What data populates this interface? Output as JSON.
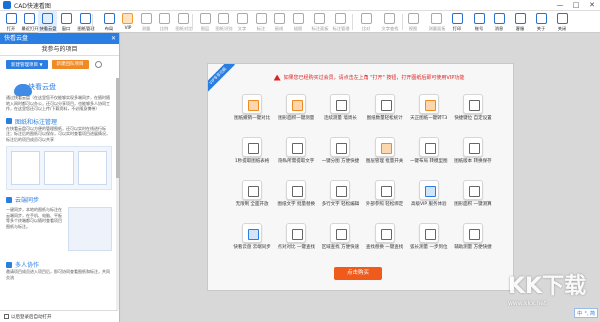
{
  "window": {
    "title": "CAD快速看图",
    "controls": [
      "—",
      "□",
      "✕"
    ]
  },
  "toolbar": {
    "items": [
      {
        "label": "打开",
        "icon": "folder-icon"
      },
      {
        "label": "最近打开",
        "icon": "recent-icon"
      },
      {
        "label": "快看云盘",
        "icon": "cloud-icon"
      },
      {
        "label": "窗口",
        "icon": "window-icon"
      },
      {
        "label": "图纸管理",
        "icon": "drawing-manage-icon"
      },
      {
        "label": "布局",
        "icon": "layout-icon"
      },
      {
        "label": "VIP",
        "icon": "vip-icon"
      },
      {
        "label": "测量",
        "icon": "measure-icon"
      },
      {
        "label": "比例",
        "icon": "scale-icon"
      },
      {
        "label": "图纸对比",
        "icon": "compare-icon"
      },
      {
        "label": "图层",
        "icon": "layers-icon"
      },
      {
        "label": "图纸识别",
        "icon": "recognize-icon"
      },
      {
        "label": "文字",
        "icon": "text-icon"
      },
      {
        "label": "标注",
        "icon": "annotate-icon"
      },
      {
        "label": "画线",
        "icon": "draw-line-icon"
      },
      {
        "label": "插图",
        "icon": "insert-image-icon"
      },
      {
        "label": "标注面板",
        "icon": "annotation-panel-icon"
      },
      {
        "label": "标注管理",
        "icon": "annotation-manage-icon"
      },
      {
        "label": "比对",
        "icon": "diff-icon"
      },
      {
        "label": "文字查找",
        "icon": "text-search-icon"
      },
      {
        "label": "视图",
        "icon": "view-icon"
      },
      {
        "label": "测量面板",
        "icon": "measure-panel-icon"
      },
      {
        "label": "打印",
        "icon": "print-icon"
      },
      {
        "label": "账号",
        "icon": "account-icon"
      },
      {
        "label": "消息",
        "icon": "message-icon"
      },
      {
        "label": "客服",
        "icon": "support-icon"
      },
      {
        "label": "关于",
        "icon": "about-icon"
      },
      {
        "label": "关闭",
        "icon": "close-doc-icon"
      }
    ]
  },
  "sidebar": {
    "header": "快看云盘",
    "tab": "我参与的项目",
    "btn_manage": "新建管理项目",
    "btn_personal": "新建团队项目",
    "cloud_title": "快看云盘",
    "intro": "通过快看云盘（在这里您不仅能够实现多端同步，在随时随地入网时都可以办公，还可以分享项目，也能够多人协同工作，在这里您还可以上传/下载资料，不必随身携带）",
    "sec1": "图纸和标注管理",
    "sec1_text": "在快看云盘可以方便的管理图纸，还可以实时在线进行标注；标注后的图纸可以保存，可以实时查看项目进展情况，标注后的项目成员可以共享",
    "sec2": "云端同步",
    "sec2_text": "一键同步，本地的图纸与标注在云端同步，在手机、电脑、平板等多个终端都可以随时查看项目图纸与标注。",
    "sec3": "多人协作",
    "sec3_text": "邀请项目成员进入项目后，即可协同查看图纸和标注，共同交流",
    "footer": "以后登录后自动打开"
  },
  "promo": {
    "ribbon": "VIP专享功能",
    "notice": "如果您已经购买过会员，请点击左上角 \"打开\" 按钮，打开图纸后即可使用VIP功能",
    "features": [
      {
        "label": "图纸撤销一键对比",
        "color": "orange"
      },
      {
        "label": "图形面积一键测量",
        "color": "orange"
      },
      {
        "label": "连续测量 墙周长",
        "color": "gray"
      },
      {
        "label": "图纸数量轻松统计",
        "color": "gray"
      },
      {
        "label": "天正图纸一键转T3",
        "color": "orange"
      },
      {
        "label": "快捷键位 自定设置",
        "color": "gray"
      },
      {
        "label": "1秒提取图纸表格",
        "color": "gray"
      },
      {
        "label": "隐私所需提取文字",
        "color": "gray"
      },
      {
        "label": "一键分图 方便快捷",
        "color": "gray"
      },
      {
        "label": "图层管理 批量开关",
        "color": "orange"
      },
      {
        "label": "一键布局 转模型图",
        "color": "gray"
      },
      {
        "label": "图纸版本 转换保存",
        "color": "gray"
      },
      {
        "label": "无限制 全面开放",
        "color": "gray"
      },
      {
        "label": "图纸文字 批量替换",
        "color": "gray"
      },
      {
        "label": "多行文字 轻松编辑",
        "color": "gray"
      },
      {
        "label": "外部参照 轻松绑定",
        "color": "gray"
      },
      {
        "label": "高级VIP 服务体验",
        "color": "blue"
      },
      {
        "label": "图形面积 一键测算",
        "color": "gray"
      },
      {
        "label": "快看云盘 云端同步",
        "color": "blue"
      },
      {
        "label": "点对对比 一键查找",
        "color": "gray"
      },
      {
        "label": "区域查找 方便快速",
        "color": "gray"
      },
      {
        "label": "查找替换 一键查找",
        "color": "gray"
      },
      {
        "label": "弧长测量 一步到位",
        "color": "gray"
      },
      {
        "label": "辅助测量 方便快捷",
        "color": "gray"
      }
    ],
    "buy_button": "点击购买"
  },
  "watermark": {
    "logo": "KK下载",
    "url": "www.kkx.net"
  },
  "ime": {
    "label": "中",
    "extra": "°, 简"
  }
}
